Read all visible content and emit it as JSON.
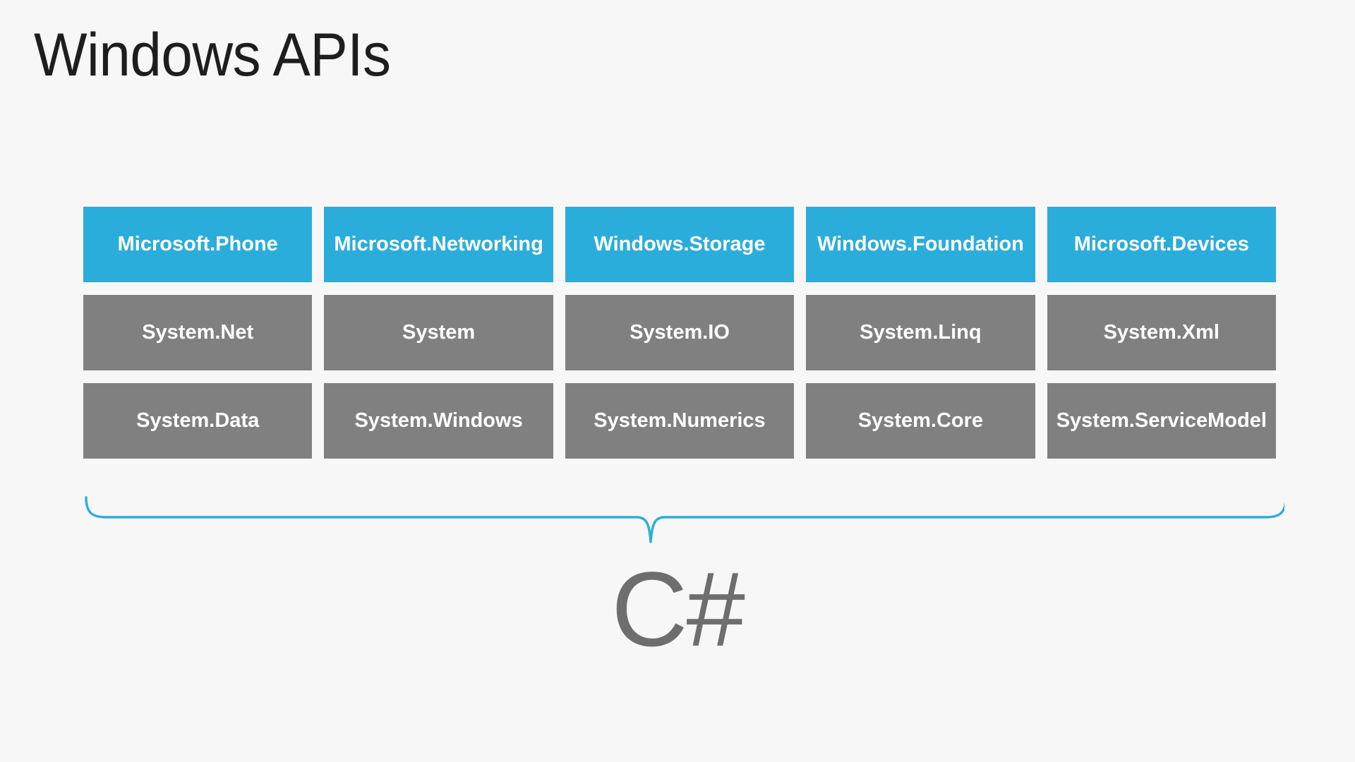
{
  "page": {
    "title": "Windows APIs",
    "background_color": "#F7F7F7",
    "accent_blue": "#2BADDB",
    "neutral_gray": "#808080",
    "title_color": "#1E1E1E"
  },
  "grid": {
    "columns": 5,
    "rows": 3,
    "cells": [
      {
        "label": "Microsoft.Phone",
        "style": "blue"
      },
      {
        "label": "Microsoft.Networking",
        "style": "blue"
      },
      {
        "label": "Windows.Storage",
        "style": "blue"
      },
      {
        "label": "Windows.Foundation",
        "style": "blue"
      },
      {
        "label": "Microsoft.Devices",
        "style": "blue"
      },
      {
        "label": "System.Net",
        "style": "gray"
      },
      {
        "label": "System",
        "style": "gray"
      },
      {
        "label": "System.IO",
        "style": "gray"
      },
      {
        "label": "System.Linq",
        "style": "gray"
      },
      {
        "label": "System.Xml",
        "style": "gray"
      },
      {
        "label": "System.Data",
        "style": "gray"
      },
      {
        "label": "System.Windows",
        "style": "gray"
      },
      {
        "label": "System.Numerics",
        "style": "gray"
      },
      {
        "label": "System.Core",
        "style": "gray"
      },
      {
        "label": "System.ServiceModel",
        "style": "gray"
      }
    ]
  },
  "brace": {
    "color": "#2BADDB",
    "orientation": "down"
  },
  "footer": {
    "language_label": "C#",
    "language_color": "#6E6E6E"
  }
}
